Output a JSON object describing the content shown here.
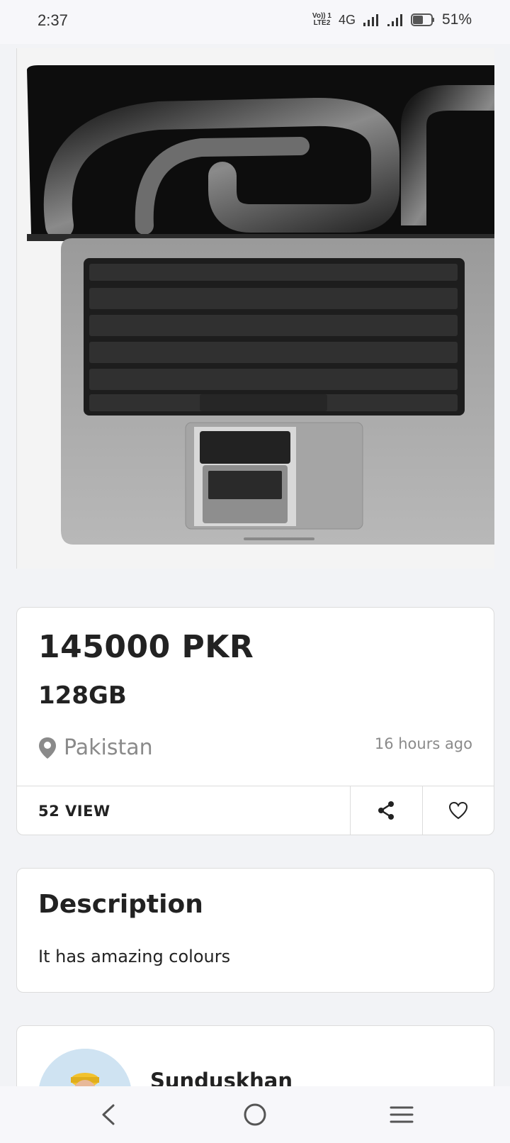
{
  "status_bar": {
    "time": "2:37",
    "volte_top": "Vo)) 1",
    "volte_bottom": "LTE2",
    "network": "4G",
    "battery": "51%"
  },
  "listing": {
    "price": "145000 PKR",
    "title": "128GB",
    "location": "Pakistan",
    "posted": "16 hours ago",
    "views": "52 VIEW"
  },
  "description": {
    "heading": "Description",
    "text": "It has amazing colours"
  },
  "seller": {
    "name": "Sunduskhan"
  },
  "icons": {
    "image": "laptop-product-photo",
    "location": "location-pin-icon",
    "share": "share-icon",
    "favorite": "heart-icon",
    "back": "back-icon",
    "home": "home-icon",
    "menu": "menu-icon"
  }
}
